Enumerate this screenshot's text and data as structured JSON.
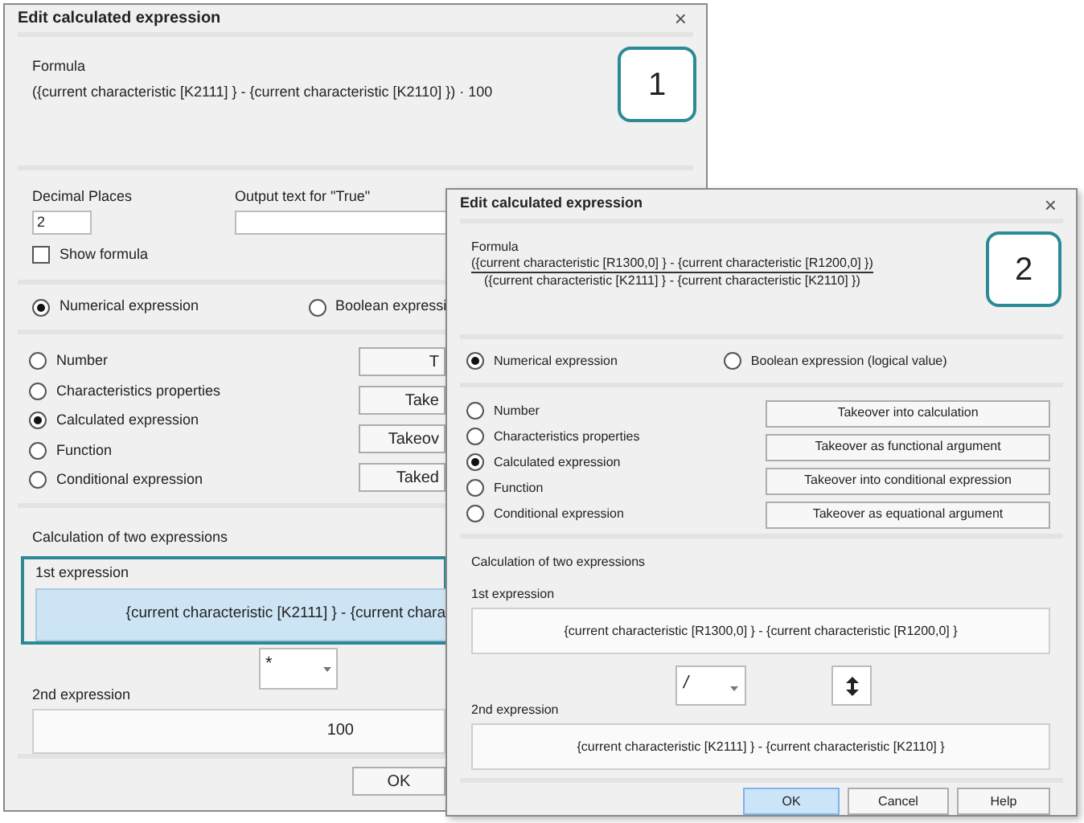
{
  "dialog_1": {
    "title": "Edit calculated expression",
    "close": "×",
    "badge": "1",
    "formula": {
      "label": "Formula",
      "value": "({current characteristic [K2111] } - {current characteristic [K2110] }) · 100"
    },
    "decimal_places": {
      "label": "Decimal Places",
      "value": "2"
    },
    "output_true": {
      "label": "Output text for \"True\""
    },
    "show_formula": {
      "label": "Show formula",
      "checked": false
    },
    "expression_types": [
      {
        "label": "Numerical expression",
        "selected": true
      },
      {
        "label": "Boolean expressi",
        "selected": false
      }
    ],
    "operand_types": [
      {
        "label": "Number",
        "selected": false
      },
      {
        "label": "Characteristics properties",
        "selected": false
      },
      {
        "label": "Calculated expression",
        "selected": true
      },
      {
        "label": "Function",
        "selected": false
      },
      {
        "label": "Conditional expression",
        "selected": false
      }
    ],
    "takeover_buttons": [
      "T",
      "Take",
      "Takeov",
      "Taked"
    ],
    "calculation_label": "Calculation of two expressions",
    "first_expression": {
      "label": "1st expression",
      "value": "{current characteristic [K2111] } - {current chara",
      "focused": true
    },
    "operator": "*",
    "second_expression": {
      "label": "2nd expression",
      "value": "100",
      "focused": false
    },
    "buttons": [
      {
        "label": "OK",
        "default": false
      }
    ]
  },
  "dialog_2": {
    "title": "Edit calculated expression",
    "close": "×",
    "badge": "2",
    "formula": {
      "label": "Formula",
      "numerator": "({current characteristic [R1300,0] } - {current characteristic [R1200,0] })",
      "denominator": "({current characteristic [K2111] } - {current characteristic [K2110] })"
    },
    "expression_types": [
      {
        "label": "Numerical expression",
        "selected": true
      },
      {
        "label": "Boolean expression (logical value)",
        "selected": false
      }
    ],
    "operand_types": [
      {
        "label": "Number",
        "selected": false
      },
      {
        "label": "Characteristics properties",
        "selected": false
      },
      {
        "label": "Calculated expression",
        "selected": true
      },
      {
        "label": "Function",
        "selected": false
      },
      {
        "label": "Conditional expression",
        "selected": false
      }
    ],
    "takeover_buttons": [
      "Takeover into calculation",
      "Takeover as functional argument",
      "Takeover into conditional expression",
      "Takeover as equational argument"
    ],
    "calculation_label": "Calculation of two expressions",
    "first_expression": {
      "label": "1st expression",
      "value": "{current characteristic [R1300,0] } - {current characteristic [R1200,0] }",
      "focused": false
    },
    "operator": "/",
    "second_expression": {
      "label": "2nd expression",
      "value": "{current characteristic [K2111] } - {current characteristic [K2110] }",
      "focused": false
    },
    "buttons": [
      {
        "label": "OK",
        "default": true
      },
      {
        "label": "Cancel",
        "default": false
      },
      {
        "label": "Help",
        "default": false
      }
    ]
  }
}
